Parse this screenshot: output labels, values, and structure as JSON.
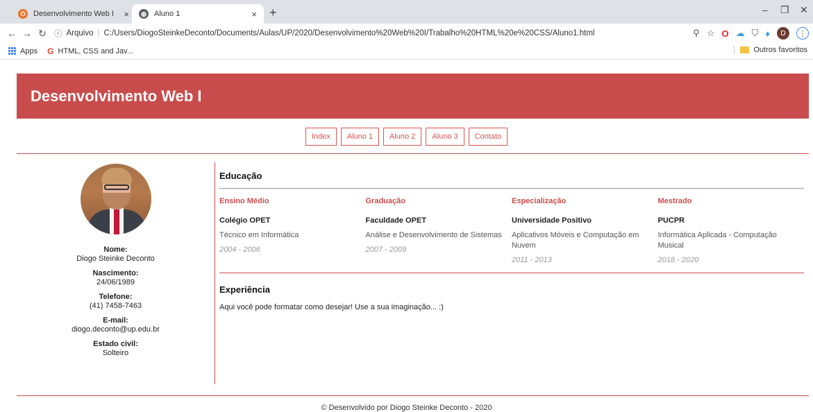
{
  "browser": {
    "tabs": [
      {
        "label": "Desenvolvimento Web I",
        "favicon": "orange-circle-icon",
        "active": false
      },
      {
        "label": "Aluno 1",
        "favicon": "globe-icon",
        "active": true
      }
    ],
    "address": {
      "security_label": "Arquivo",
      "url": "C:/Users/DiogoSteinkeDeconto/Documents/Aulas/UP/2020/Desenvolvimento%20Web%20I/Trabalho%20HTML%20e%20CSS/Aluno1.html"
    },
    "profile_initial": "D",
    "bookmarks": {
      "apps_label": "Apps",
      "items": [
        "HTML, CSS and Jav..."
      ],
      "other_label": "Outros favoritos"
    }
  },
  "site": {
    "title": "Desenvolvimento Web I",
    "menu": [
      "Index",
      "Aluno 1",
      "Aluno 2",
      "Aluno 3",
      "Contato"
    ],
    "profile": {
      "fields": [
        {
          "label": "Nome:",
          "value": "Diogo Steinke Deconto"
        },
        {
          "label": "Nascimento:",
          "value": "24/06/1989"
        },
        {
          "label": "Telefone:",
          "value": "(41) 7458-7463"
        },
        {
          "label": "E-mail:",
          "value": "diogo.deconto@up.edu.br"
        },
        {
          "label": "Estado civil:",
          "value": "Solteiro"
        }
      ]
    },
    "education": {
      "title": "Educação",
      "items": [
        {
          "level": "Ensino Médio",
          "institution": "Colégio OPET",
          "course": "Técnico em Informática",
          "years": "2004 - 2006"
        },
        {
          "level": "Graduação",
          "institution": "Faculdade OPET",
          "course": "Análise e Desenvolvimento de Sistemas",
          "years": "2007 - 2009"
        },
        {
          "level": "Especialização",
          "institution": "Universidade Positivo",
          "course": "Aplicativos Móveis e Computação em Nuvem",
          "years": "2011 - 2013"
        },
        {
          "level": "Mestrado",
          "institution": "PUCPR",
          "course": "Informática Aplicada - Computação Musical",
          "years": "2018 - 2020"
        }
      ]
    },
    "experience": {
      "title": "Experiência",
      "text": "Aqui você pode formatar como desejar! Use a sua imaginação... :)"
    },
    "footer": "© Desenvolvido por Diogo Steinke Deconto - 2020",
    "colors": {
      "accent": "#c94c4c",
      "menu_border": "#d9534f"
    }
  }
}
